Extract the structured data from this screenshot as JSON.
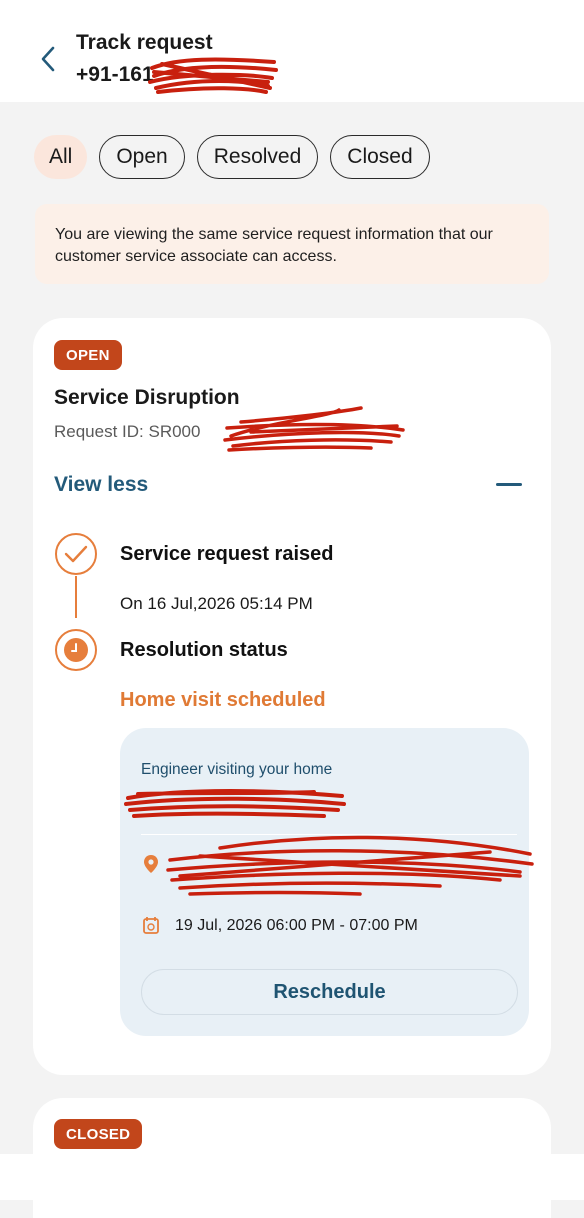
{
  "header": {
    "title": "Track request",
    "phone": "+91-161"
  },
  "filters": [
    {
      "label": "All",
      "active": true
    },
    {
      "label": "Open",
      "active": false
    },
    {
      "label": "Resolved",
      "active": false
    },
    {
      "label": "Closed",
      "active": false
    }
  ],
  "notice": "You are viewing the same service request information that our customer service associate can access.",
  "request": {
    "status_badge": "OPEN",
    "title": "Service Disruption",
    "request_id": "Request ID: SR000",
    "toggle_label": "View less",
    "steps": [
      {
        "title": "Service request raised",
        "subtitle": "On 16 Jul,2026 05:14 PM"
      },
      {
        "title": "Resolution status",
        "subtitle": "Home visit scheduled"
      }
    ],
    "visit": {
      "label": "Engineer visiting your home",
      "slot": "19 Jul, 2026 06:00 PM - 07:00 PM",
      "button_label": "Reschedule"
    }
  },
  "next_request": {
    "status_badge": "CLOSED"
  },
  "colors": {
    "accent_orange": "#e07a35",
    "badge_red": "#c2461b",
    "link_blue": "#235a7a",
    "redaction_red": "#c8200e"
  },
  "icons": [
    "chevron-left-icon",
    "minus-icon",
    "check-icon",
    "clock-icon",
    "location-pin-icon",
    "calendar-icon"
  ]
}
